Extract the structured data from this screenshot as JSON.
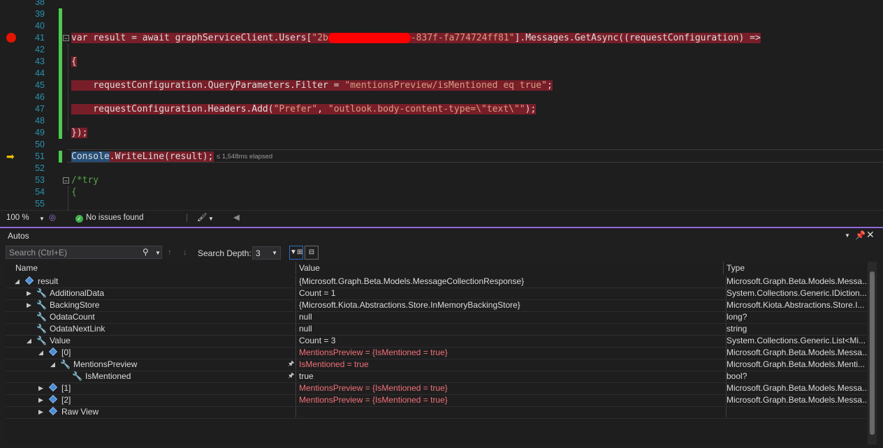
{
  "editor": {
    "lines": [
      {
        "n": "38"
      },
      {
        "n": "39"
      },
      {
        "n": "40"
      },
      {
        "n": "41"
      },
      {
        "n": "42"
      },
      {
        "n": "43"
      },
      {
        "n": "44"
      },
      {
        "n": "45"
      },
      {
        "n": "46"
      },
      {
        "n": "47"
      },
      {
        "n": "48"
      },
      {
        "n": "49"
      },
      {
        "n": "50"
      },
      {
        "n": "51"
      },
      {
        "n": "52"
      },
      {
        "n": "53"
      },
      {
        "n": "54"
      },
      {
        "n": "55"
      }
    ],
    "code": {
      "l41_a": "var result = await graphServiceClient.Users[",
      "l41_str1": "\"2b",
      "l41_str2": "-837f-fa774724ff81\"",
      "l41_b": "].Messages.GetAsync((requestConfiguration) =>",
      "l43": "{",
      "l45_a": "    requestConfiguration.QueryParameters.Filter = ",
      "l45_str": "\"mentionsPreview/isMentioned eq true\"",
      "l45_b": ";",
      "l47_a": "    requestConfiguration.Headers.Add(",
      "l47_str1": "\"Prefer\"",
      "l47_mid": ", ",
      "l47_str2": "\"outlook.body-content-type=\\\"text\\\"\"",
      "l47_b": ");",
      "l49": "});",
      "l51_a": "Console",
      "l51_b": ".WriteLine(result);",
      "l51_elapsed": "≤ 1,548ms elapsed",
      "l53": "/*try",
      "l54": "{"
    }
  },
  "strip": {
    "zoom": "100 %",
    "issues": "No issues found"
  },
  "autos": {
    "title": "Autos",
    "search_placeholder": "Search (Ctrl+E)",
    "depth_label": "Search Depth:",
    "depth_value": "3",
    "columns": {
      "name": "Name",
      "value": "Value",
      "type": "Type"
    },
    "rows": [
      {
        "name": "result",
        "value": "{Microsoft.Graph.Beta.Models.MessageCollectionResponse}",
        "type": "Microsoft.Graph.Beta.Models.Messa..."
      },
      {
        "name": "AdditionalData",
        "value": "Count = 1",
        "type": "System.Collections.Generic.IDiction..."
      },
      {
        "name": "BackingStore",
        "value": "{Microsoft.Kiota.Abstractions.Store.InMemoryBackingStore}",
        "type": "Microsoft.Kiota.Abstractions.Store.I..."
      },
      {
        "name": "OdataCount",
        "value": "null",
        "type": "long?"
      },
      {
        "name": "OdataNextLink",
        "value": "null",
        "type": "string"
      },
      {
        "name": "Value",
        "value": "Count = 3",
        "type": "System.Collections.Generic.List<Mi..."
      },
      {
        "name": "[0]",
        "value": "MentionsPreview = {IsMentioned = true}",
        "type": "Microsoft.Graph.Beta.Models.Messa..."
      },
      {
        "name": "MentionsPreview",
        "value": "IsMentioned = true",
        "type": "Microsoft.Graph.Beta.Models.Menti..."
      },
      {
        "name": "IsMentioned",
        "value": "true",
        "type": "bool?"
      },
      {
        "name": "[1]",
        "value": "MentionsPreview = {IsMentioned = true}",
        "type": "Microsoft.Graph.Beta.Models.Messa..."
      },
      {
        "name": "[2]",
        "value": "MentionsPreview = {IsMentioned = true}",
        "type": "Microsoft.Graph.Beta.Models.Messa..."
      },
      {
        "name": "Raw View",
        "value": "",
        "type": ""
      }
    ]
  },
  "colors": {
    "breakpoint": "#e51400",
    "highlight": "#781e28",
    "accent": "#8f6ad8",
    "changed": "#f1707a"
  }
}
